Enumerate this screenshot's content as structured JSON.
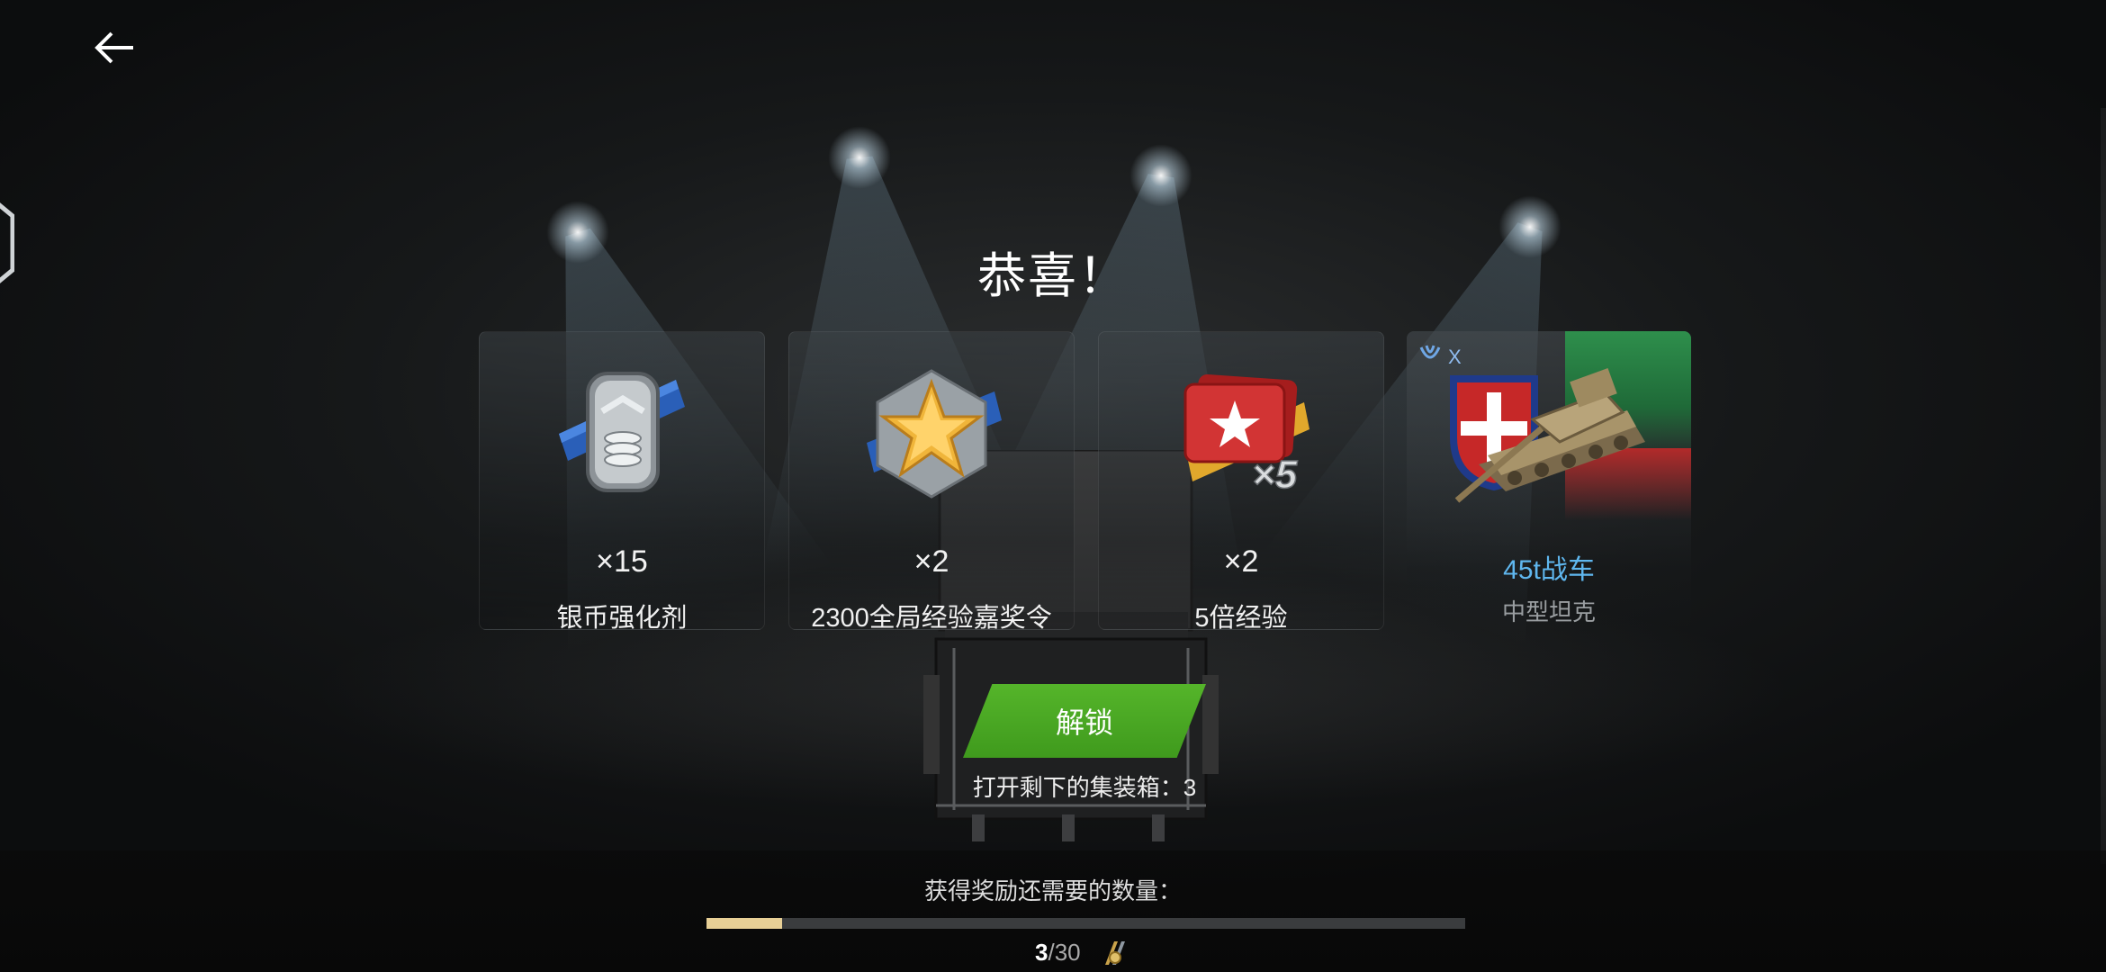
{
  "header": {
    "back_icon": "arrow-left-icon"
  },
  "title": "恭喜！",
  "rewards": [
    {
      "icon": "silver-booster-icon",
      "count": "×15",
      "name": "银币强化剂"
    },
    {
      "icon": "xp-star-order-icon",
      "count": "×2",
      "name": "2300全局经验嘉奖令"
    },
    {
      "icon": "xp-cards-x5-icon",
      "count": "×2",
      "name": "5倍经验"
    }
  ],
  "tank": {
    "tier_label": "X",
    "name": "45t战车",
    "type": "中型坦克"
  },
  "unlock": {
    "button_label": "解锁",
    "remaining_text": "打开剩下的集装箱：3"
  },
  "progress": {
    "label": "获得奖励还需要的数量：",
    "current": "3",
    "total": "/30",
    "fraction": 0.1
  },
  "colors": {
    "accent_green": "#4caf24",
    "tank_name": "#5fb7ef",
    "progress_fill": "#e7cf96"
  }
}
